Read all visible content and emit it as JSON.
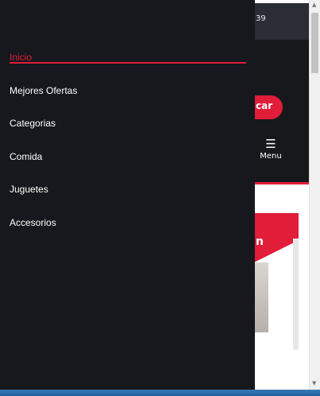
{
  "background": {
    "topbar_text": "39",
    "search_button_label": "car",
    "menu_label": "Menu",
    "card_letter": "n"
  },
  "drawer": {
    "items": [
      {
        "label": "Inicio",
        "active": true
      },
      {
        "label": "Mejores Ofertas",
        "active": false
      },
      {
        "label": "Categorias",
        "active": false
      },
      {
        "label": "Comida",
        "active": false
      },
      {
        "label": "Juguetes",
        "active": false
      },
      {
        "label": "Accesorios",
        "active": false
      }
    ]
  },
  "colors": {
    "accent": "#e11d39",
    "drawer_bg": "#17181d",
    "text": "#ffffff"
  },
  "icons": {
    "menu": "hamburger-icon",
    "scroll_up": "caret-up-icon",
    "scroll_down": "caret-down-icon"
  }
}
